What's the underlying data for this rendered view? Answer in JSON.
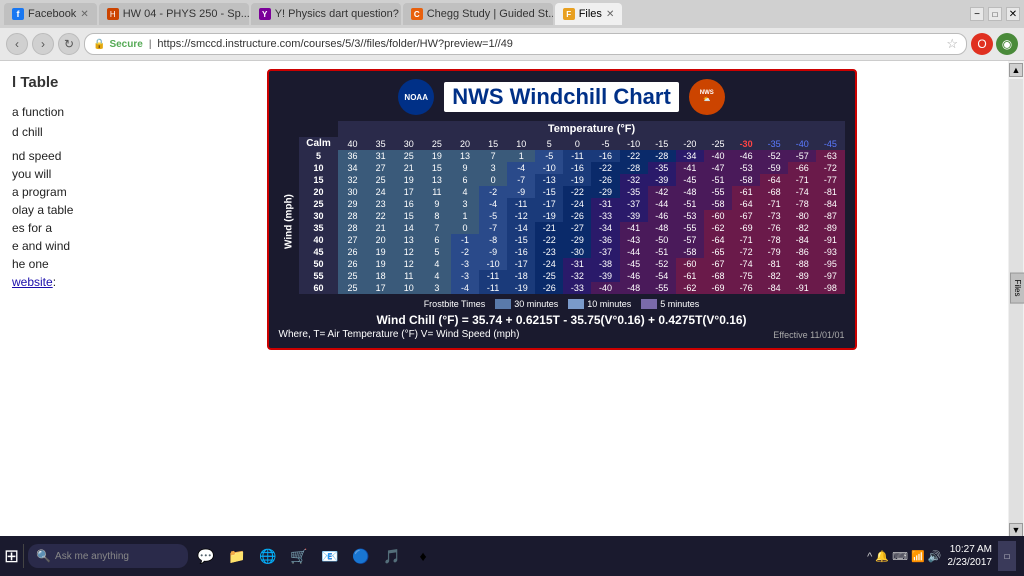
{
  "browser": {
    "tabs": [
      {
        "id": "facebook",
        "label": "Facebook",
        "favicon": "f",
        "active": false
      },
      {
        "id": "hw04",
        "label": "HW 04 - PHYS 250 - Sp...",
        "favicon": "hw",
        "active": false
      },
      {
        "id": "physics",
        "label": "Y! Physics dart question? |...",
        "favicon": "y",
        "active": false
      },
      {
        "id": "chegg",
        "label": "Chegg Study | Guided St...",
        "favicon": "c",
        "active": false
      },
      {
        "id": "files",
        "label": "Files",
        "favicon": "F",
        "active": true
      }
    ],
    "url": "https://smccd.instructure.com/courses/5/3//files/folder/HW?preview=1//49",
    "secure_label": "Secure"
  },
  "sidebar": {
    "heading": "l Table",
    "paragraph1": "a function",
    "paragraph2": "d chill",
    "paragraph3": "",
    "paragraph4": "nd speed",
    "paragraph5": "you will",
    "paragraph6": "a program",
    "paragraph7": "olay a table",
    "paragraph8": "es for a",
    "paragraph9": "e and wind",
    "paragraph10": "he one",
    "link_text": "website",
    "link_suffix": ":"
  },
  "chart": {
    "title": "NWS Windchill Chart",
    "temp_label": "Temperature (°F)",
    "wind_label": "Wind (mph)",
    "temp_headers": [
      "Calm",
      "40",
      "35",
      "30",
      "25",
      "20",
      "15",
      "10",
      "5",
      "0",
      "-5",
      "-10",
      "-15",
      "-20",
      "-25",
      "-30",
      "-35",
      "-40",
      "-45"
    ],
    "wind_speeds": [
      "5",
      "10",
      "15",
      "20",
      "25",
      "30",
      "35",
      "40",
      "45",
      "50",
      "55",
      "60"
    ],
    "data": [
      [
        36,
        31,
        25,
        19,
        13,
        7,
        1,
        -5,
        -11,
        -16,
        -22,
        -28,
        -34,
        -40,
        -46,
        -52,
        -57,
        -63
      ],
      [
        34,
        27,
        21,
        15,
        9,
        3,
        -4,
        -10,
        -16,
        -22,
        -28,
        -35,
        -41,
        -47,
        -53,
        -59,
        -66,
        -72
      ],
      [
        32,
        25,
        19,
        13,
        6,
        0,
        -7,
        -13,
        -19,
        -26,
        -32,
        -39,
        -45,
        -51,
        -58,
        -64,
        -71,
        -77
      ],
      [
        30,
        24,
        17,
        11,
        4,
        -2,
        -9,
        -15,
        -22,
        -29,
        -35,
        -42,
        -48,
        -55,
        -61,
        -68,
        -74,
        -81
      ],
      [
        29,
        23,
        16,
        9,
        3,
        -4,
        -11,
        -17,
        -24,
        -31,
        -37,
        -44,
        -51,
        -58,
        -64,
        -71,
        -78,
        -84
      ],
      [
        28,
        22,
        15,
        8,
        1,
        -5,
        -12,
        -19,
        -26,
        -33,
        -39,
        -46,
        -53,
        -60,
        -67,
        -73,
        -80,
        -87
      ],
      [
        28,
        21,
        14,
        7,
        0,
        -7,
        -14,
        -21,
        -27,
        -34,
        -41,
        -48,
        -55,
        -62,
        -69,
        -76,
        -82,
        -89
      ],
      [
        27,
        20,
        13,
        6,
        -1,
        -8,
        -15,
        -22,
        -29,
        -36,
        -43,
        -50,
        -57,
        -64,
        -71,
        -78,
        -84,
        -91
      ],
      [
        26,
        19,
        12,
        5,
        -2,
        -9,
        -16,
        -23,
        -30,
        -37,
        -44,
        -51,
        -58,
        -65,
        -72,
        -79,
        -86,
        -93
      ],
      [
        26,
        19,
        12,
        4,
        -3,
        -10,
        -17,
        -24,
        -31,
        -38,
        -45,
        -52,
        -60,
        -67,
        -74,
        -81,
        -88,
        -95
      ],
      [
        25,
        18,
        11,
        4,
        -3,
        -11,
        -18,
        -25,
        -32,
        -39,
        -46,
        -54,
        -61,
        -68,
        -75,
        -82,
        -89,
        -97
      ],
      [
        25,
        17,
        10,
        3,
        -4,
        -11,
        -19,
        -26,
        -33,
        -40,
        -48,
        -55,
        -62,
        -69,
        -76,
        -84,
        -91,
        -98
      ]
    ],
    "frostbite_label": "Frostbite Times",
    "legend": [
      {
        "label": "30 minutes",
        "color": "#5a7aaa"
      },
      {
        "label": "10 minutes",
        "color": "#7a9aca"
      },
      {
        "label": "5 minutes",
        "color": "#7a5a9a"
      }
    ],
    "formula": "Wind Chill (°F) = 35.74 + 0.6215T - 35.75(V°0.16) + 0.4275T(V°0.16)",
    "formula_note": "Where, T= Air Temperature (°F)  V= Wind Speed (mph)",
    "effective": "Effective 11/01/01"
  },
  "taskbar": {
    "search_placeholder": "Ask me anything",
    "time": "10:27 AM",
    "date": "2/23/2017",
    "apps": [
      "⊞",
      "🔍",
      "💬",
      "📁",
      "🗂",
      "🖥",
      "📦",
      "🎵",
      "♦"
    ]
  }
}
